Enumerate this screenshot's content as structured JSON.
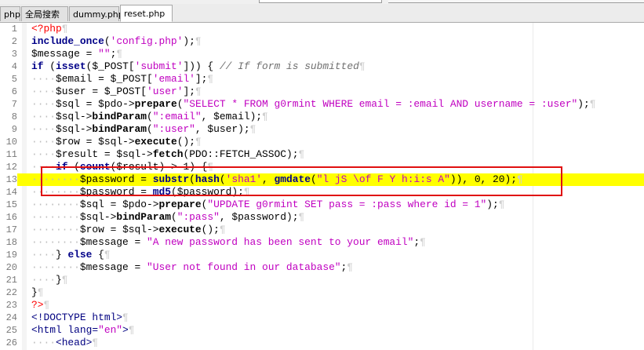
{
  "tabs": [
    {
      "label": "php"
    },
    {
      "label": "全局搜索"
    },
    {
      "label": "dummy.php"
    },
    {
      "label": "reset.php",
      "active": true
    }
  ],
  "colors": {
    "highlight": "#ffff00",
    "annotation_box": "#e01010"
  },
  "code": {
    "lines": [
      {
        "n": "1",
        "text": "<?php"
      },
      {
        "n": "2",
        "text": "include_once('config.php');"
      },
      {
        "n": "3",
        "text": "$message = \"\";"
      },
      {
        "n": "4",
        "text": "if (isset($_POST['submit'])) { // If form is submitted"
      },
      {
        "n": "5",
        "text": "    $email = $_POST['email'];"
      },
      {
        "n": "6",
        "text": "    $user = $_POST['user'];"
      },
      {
        "n": "7",
        "text": "    $sql = $pdo->prepare(\"SELECT * FROM g0rmint WHERE email = :email AND username = :user\");"
      },
      {
        "n": "8",
        "text": "    $sql->bindParam(\":email\", $email);"
      },
      {
        "n": "9",
        "text": "    $sql->bindParam(\":user\", $user);"
      },
      {
        "n": "10",
        "text": "    $row = $sql->execute();"
      },
      {
        "n": "11",
        "text": "    $result = $sql->fetch(PDO::FETCH_ASSOC);"
      },
      {
        "n": "12",
        "text": "    if (count($result) > 1) {"
      },
      {
        "n": "13",
        "text": "        $password = substr(hash('sha1', gmdate(\"l jS \\of F Y h:i:s A\")), 0, 20);"
      },
      {
        "n": "14",
        "text": "        $password = md5($password);"
      },
      {
        "n": "15",
        "text": "        $sql = $pdo->prepare(\"UPDATE g0rmint SET pass = :pass where id = 1\");"
      },
      {
        "n": "16",
        "text": "        $sql->bindParam(\":pass\", $password);"
      },
      {
        "n": "17",
        "text": "        $row = $sql->execute();"
      },
      {
        "n": "18",
        "text": "        $message = \"A new password has been sent to your email\";"
      },
      {
        "n": "19",
        "text": "    } else {"
      },
      {
        "n": "20",
        "text": "        $message = \"User not found in our database\";"
      },
      {
        "n": "21",
        "text": "    }"
      },
      {
        "n": "22",
        "text": "}"
      },
      {
        "n": "23",
        "text": "?>"
      },
      {
        "n": "24",
        "text": "<!DOCTYPE html>"
      },
      {
        "n": "25",
        "text": "<html lang=\"en\">"
      },
      {
        "n": "26",
        "text": "    <head>"
      }
    ],
    "highlighted_line": "13"
  }
}
